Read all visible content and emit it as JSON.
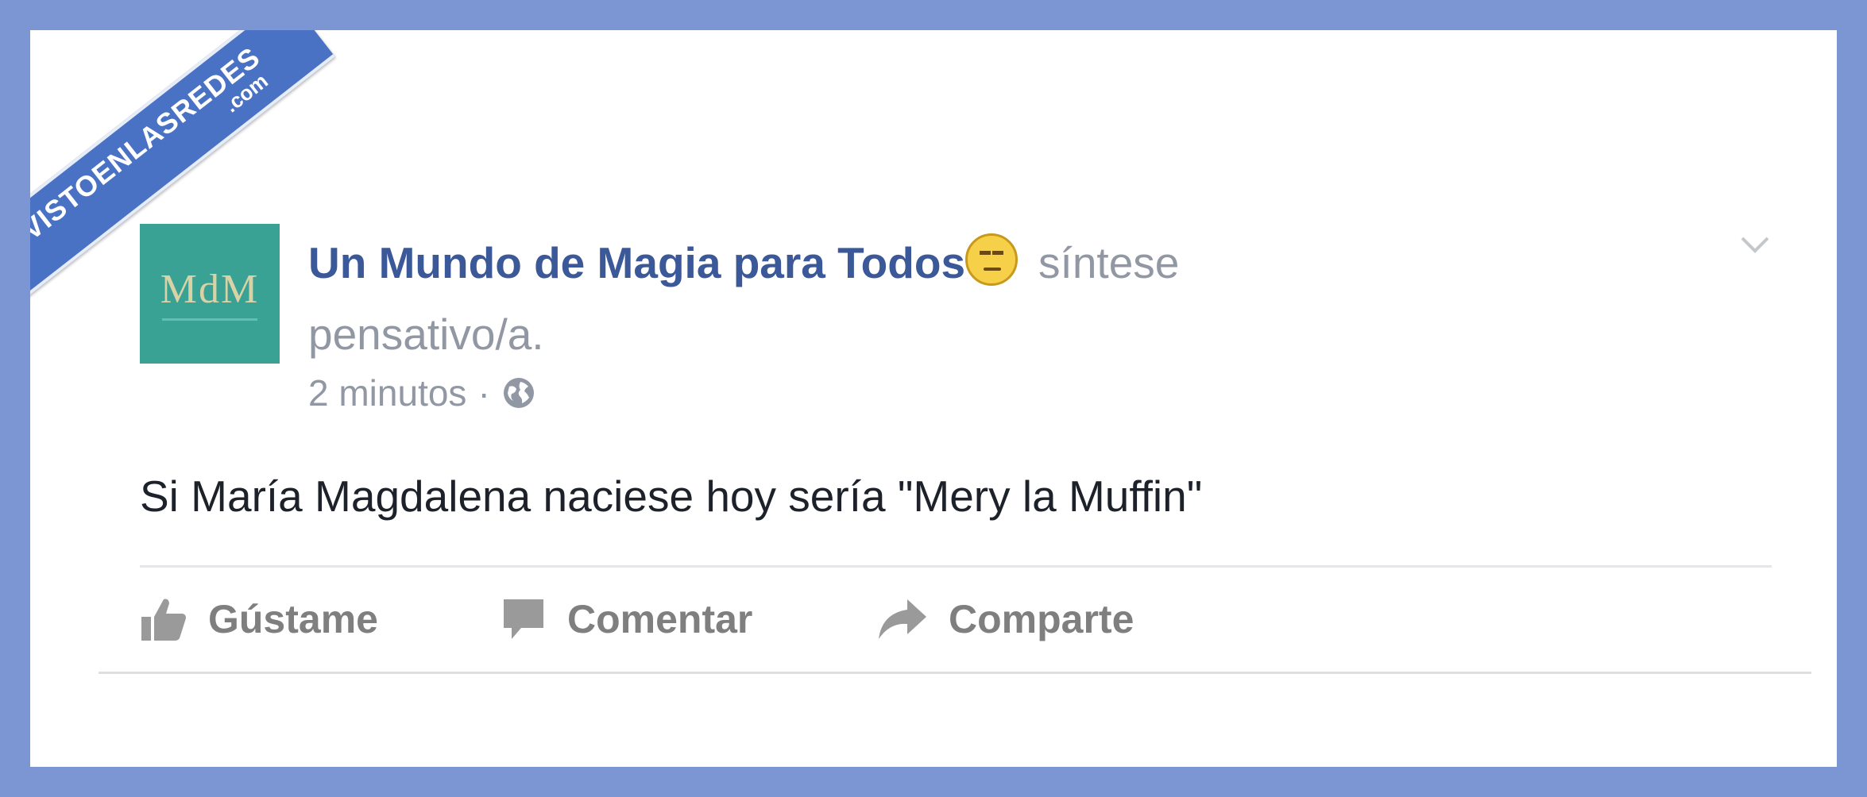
{
  "watermark": {
    "main": "VISTOENLASREDES",
    "sub": ".com"
  },
  "post": {
    "avatar_text": "MdM",
    "page_name": "Un Mundo de Magia para Todos",
    "feeling": "síntese pensativo/a.",
    "timestamp": "2 minutos",
    "separator": "·",
    "privacy_icon": "globe-icon",
    "emoji_icon": "pensive-face-icon",
    "text": "Si María Magdalena naciese hoy sería \"Mery la Muffin\""
  },
  "actions": {
    "like_label": "Gústame",
    "comment_label": "Comentar",
    "share_label": "Comparte"
  },
  "colors": {
    "frame": "#7b96d2",
    "page_name": "#3b5998",
    "avatar_bg": "#3aa294",
    "secondary_text": "#9197a3",
    "action_text": "#7f7f7f"
  }
}
